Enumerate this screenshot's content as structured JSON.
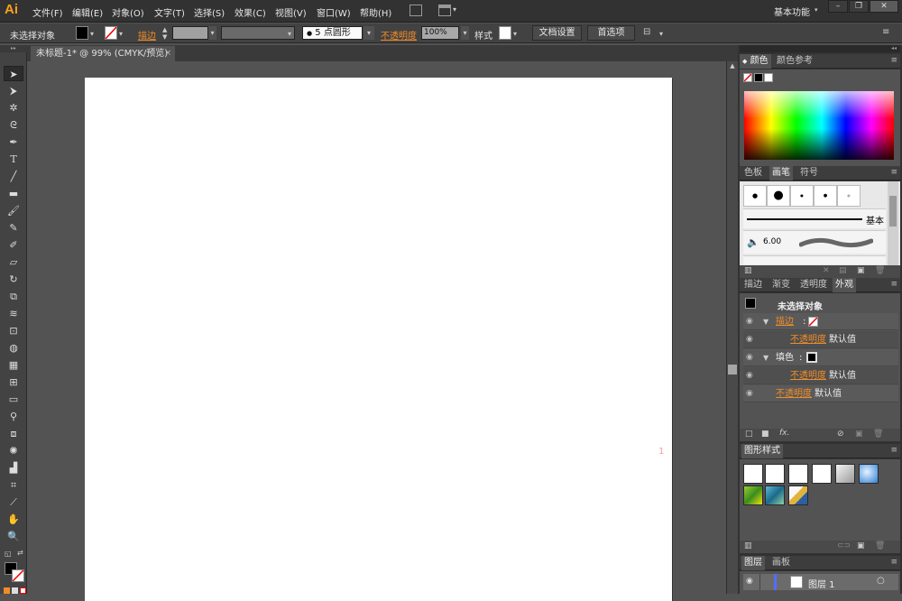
{
  "app": {
    "logo": "Ai",
    "workspace": "基本功能"
  },
  "menu": [
    "文件(F)",
    "编辑(E)",
    "对象(O)",
    "文字(T)",
    "选择(S)",
    "效果(C)",
    "视图(V)",
    "窗口(W)",
    "帮助(H)"
  ],
  "window_controls": {
    "minimize": "–",
    "maximize": "❐",
    "close": "✕"
  },
  "control_bar": {
    "selection_label": "未选择对象",
    "stroke_label": "描边",
    "brush_value": "5 点圆形",
    "opacity_label": "不透明度",
    "opacity_value": "100%",
    "style_label": "样式",
    "doc_setup_button": "文档设置",
    "preferences_button": "首选项"
  },
  "document_tab": {
    "title": "未标题-1* @ 99% (CMYK/预览)",
    "close": "×"
  },
  "canvas": {
    "artboard_number": "1"
  },
  "panels": {
    "color": {
      "tabs": [
        "颜色",
        "颜色参考"
      ]
    },
    "brushes": {
      "tabs": [
        "色板",
        "画笔",
        "符号"
      ],
      "basic_label": "基本",
      "size_value": "6.00"
    },
    "appearance": {
      "tabs": [
        "描边",
        "渐变",
        "透明度",
        "外观"
      ],
      "title": "未选择对象",
      "stroke_label": "描边",
      "fill_label": "填色",
      "opacity_label": "不透明度",
      "default_value": "默认值"
    },
    "graphic_styles": {
      "tabs": [
        "图形样式"
      ]
    },
    "layers": {
      "tabs": [
        "图层",
        "画板"
      ],
      "layer_name": "图层 1"
    }
  },
  "colors": {
    "accent": "#f08c28",
    "logo": "#f7a21b",
    "ui_bg": "#535353"
  }
}
